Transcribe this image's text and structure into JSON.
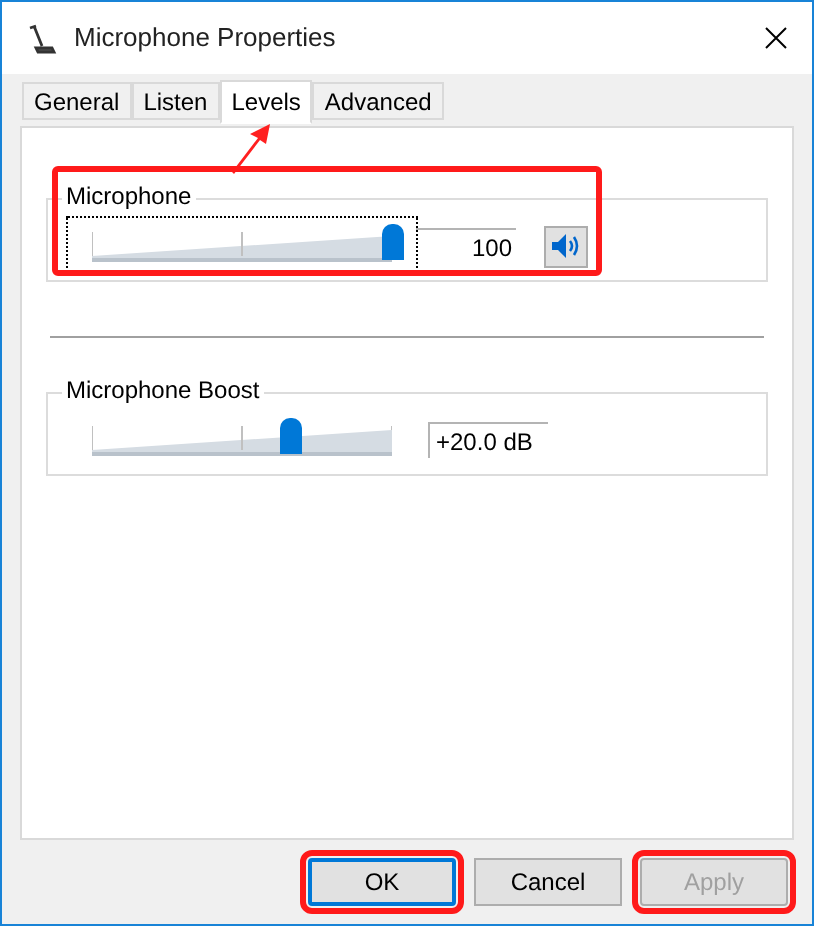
{
  "window": {
    "title": "Microphone Properties"
  },
  "tabs": [
    {
      "label": "General",
      "selected": false,
      "annotated": false
    },
    {
      "label": "Listen",
      "selected": false,
      "annotated": false
    },
    {
      "label": "Levels",
      "selected": true,
      "annotated": true
    },
    {
      "label": "Advanced",
      "selected": false,
      "annotated": false
    }
  ],
  "groups": [
    {
      "label": "Microphone",
      "level": 1,
      "value": "100",
      "focused": true,
      "highlighted": true,
      "kind": "volume"
    },
    {
      "label": "Microphone Boost",
      "level": 0.66,
      "value": "+20.0 dB",
      "focused": false,
      "highlighted": false,
      "kind": "boost"
    }
  ],
  "buttons": [
    {
      "label": "OK",
      "default": true,
      "disabled": false,
      "highlighted": true
    },
    {
      "label": "Cancel",
      "default": false,
      "disabled": false,
      "highlighted": false
    },
    {
      "label": "Apply",
      "default": false,
      "disabled": true,
      "highlighted": true
    }
  ]
}
